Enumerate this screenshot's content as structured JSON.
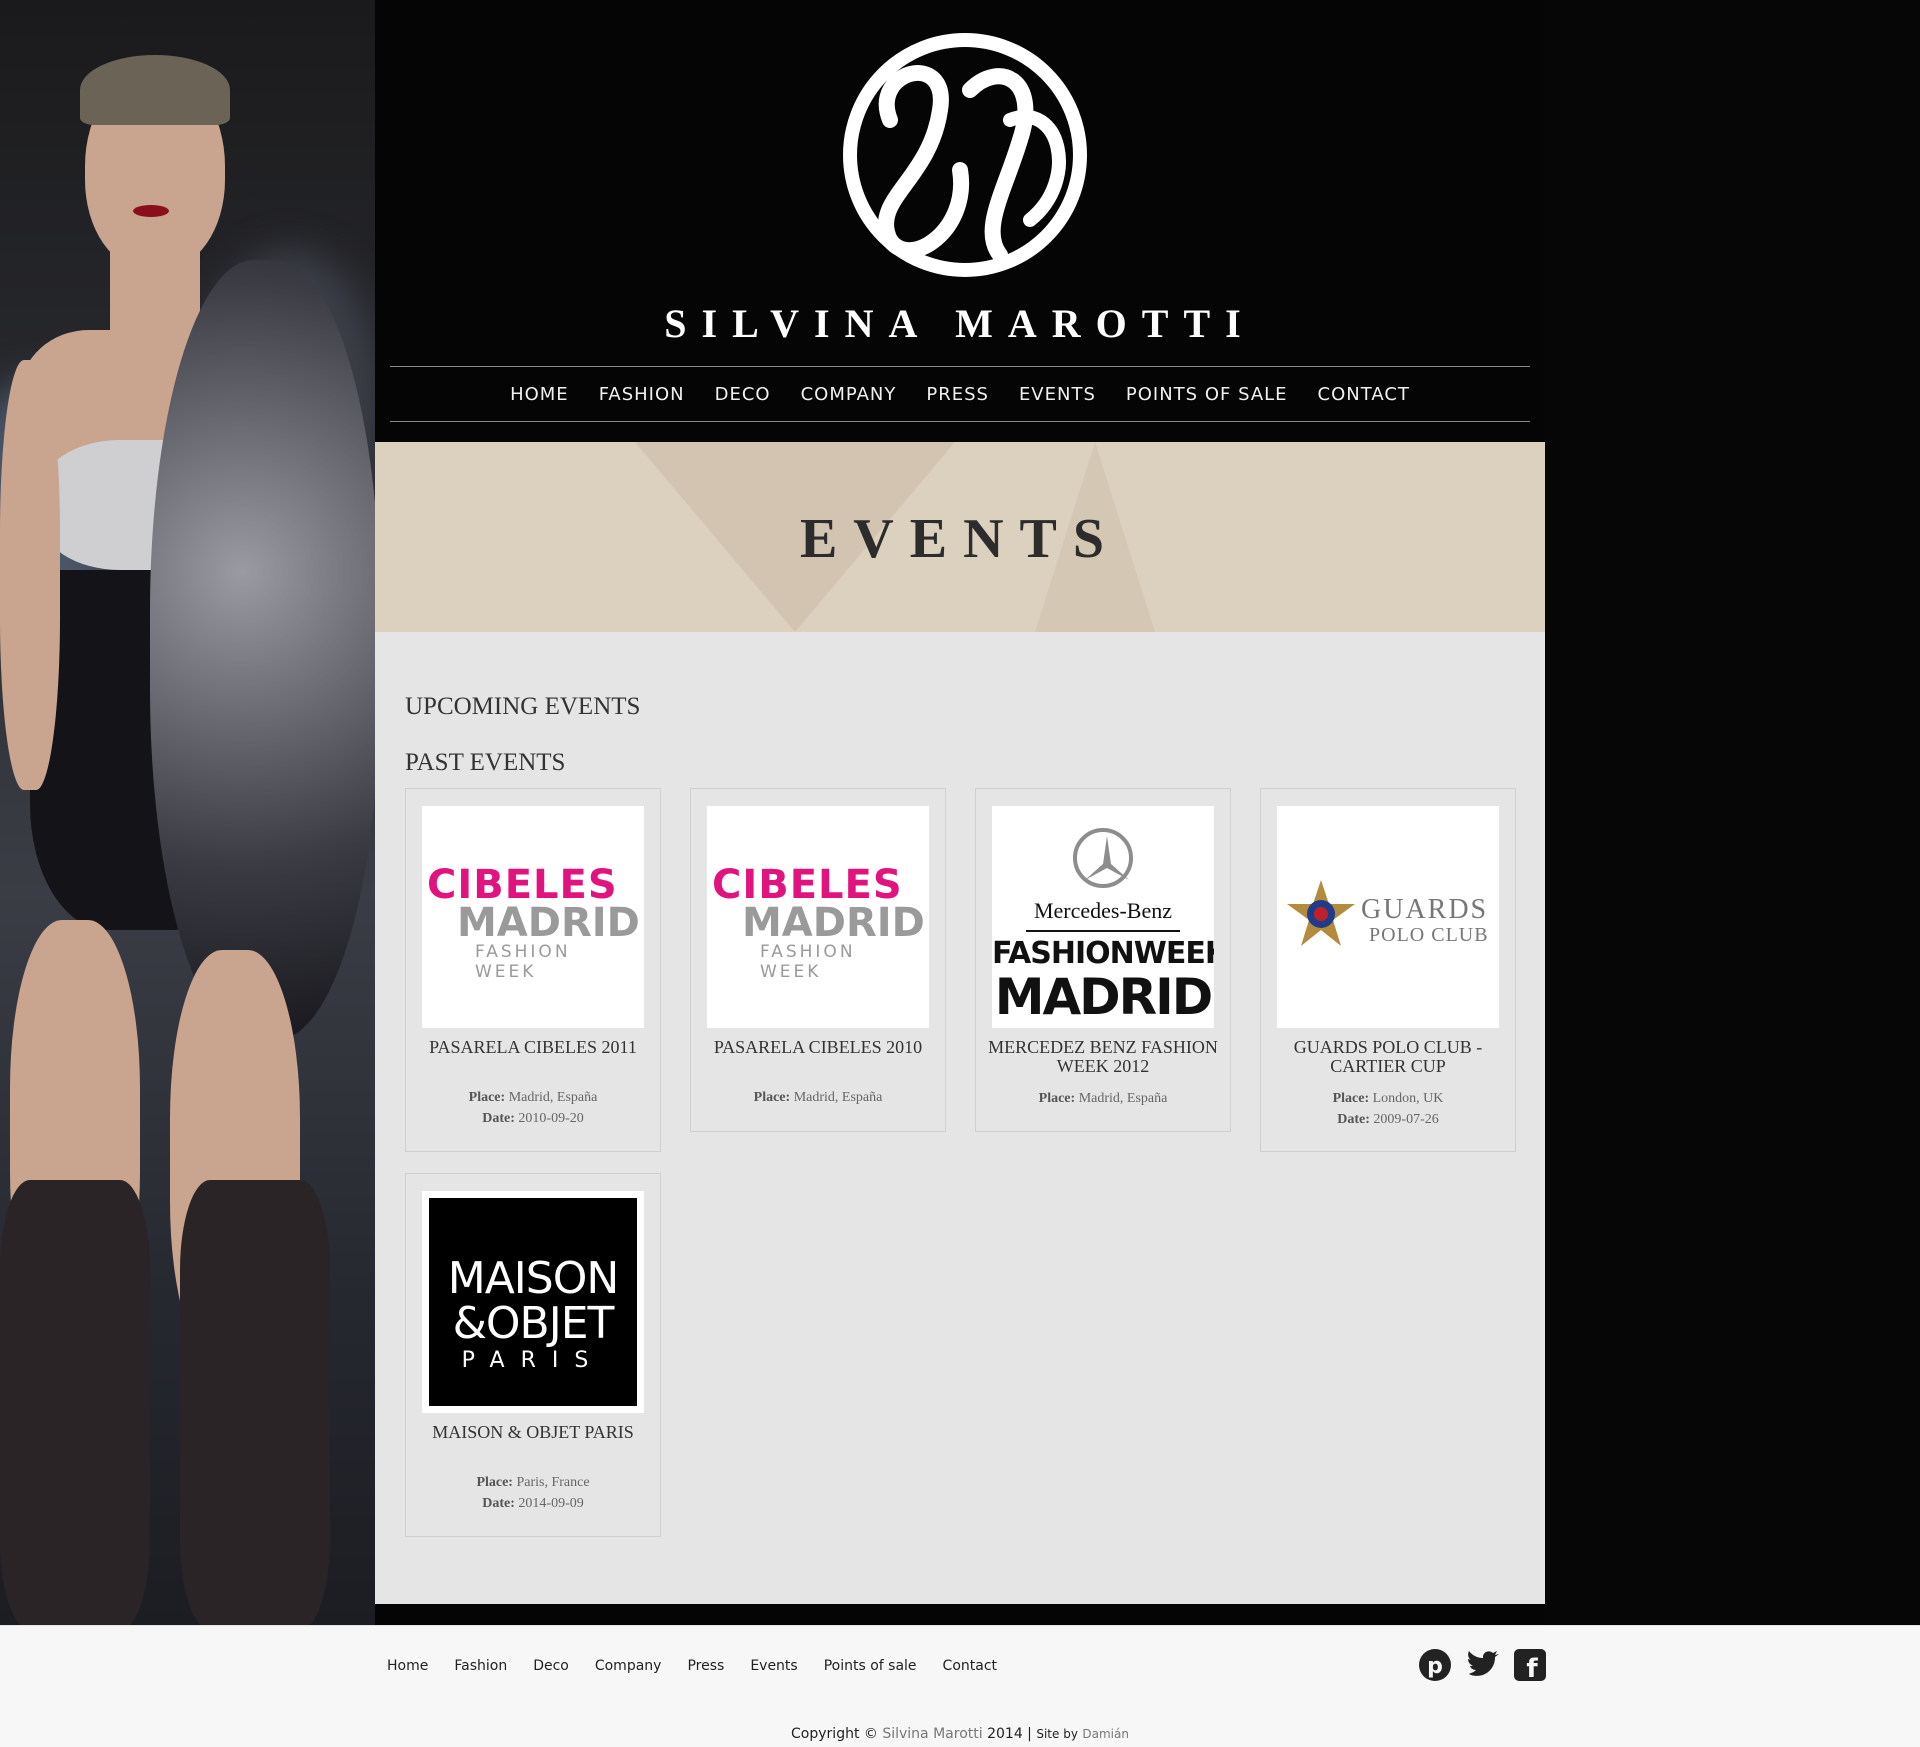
{
  "brand": {
    "name": "SILVINA MAROTTI",
    "logo_icon": "monogram-logo-icon"
  },
  "nav": {
    "items": [
      "HOME",
      "FASHION",
      "DECO",
      "COMPANY",
      "PRESS",
      "EVENTS",
      "POINTS OF SALE",
      "CONTACT"
    ]
  },
  "page": {
    "title": "EVENTS",
    "upcoming_heading": "UPCOMING EVENTS",
    "past_heading": "PAST EVENTS"
  },
  "events": [
    {
      "title": "PASAREL A CIBELES 2011",
      "place_label": "Place:",
      "place": "Madrid, España",
      "date_label": "Date:",
      "date": "2010-09-20",
      "logo": "cibeles-logo"
    },
    {
      "title": "PASARELA CIBELES 2010",
      "place_label": "Place:",
      "place": "Madrid, España",
      "logo": "cibeles-logo"
    },
    {
      "title": "MERCEDEZ BENZ FASHION WEEK 2012",
      "place_label": "Place:",
      "place": "Madrid, España",
      "logo": "mercedes-fashionweek-logo"
    },
    {
      "title": "GUARDS POLO CLUB - CARTIER CUP",
      "place_label": "Place:",
      "place": "London, UK",
      "date_label": "Date:",
      "date": "2009-07-26",
      "logo": "guards-polo-logo"
    },
    {
      "title": "MAISON & OBJET PARIS",
      "place_label": "Place:",
      "place": "Paris, France",
      "date_label": "Date:",
      "date": "2014-09-09",
      "logo": "maison-objet-logo"
    }
  ],
  "logos": {
    "cibeles": {
      "line1": "CIBELES",
      "line2": "MADRID",
      "line3": "FASHION WEEK"
    },
    "mercedes": {
      "line1": "Mercedes-Benz",
      "line2": "FASHIONWEEK",
      "line3": "MADRID"
    },
    "guards": {
      "line1": "GUARDS",
      "line2": "POLO CLUB"
    },
    "maison": {
      "line1": "MAISON",
      "line2": "&OBJET",
      "line3": "PARIS"
    }
  },
  "footer": {
    "nav": [
      "Home",
      "Fashion",
      "Deco",
      "Company",
      "Press",
      "Events",
      "Points of sale",
      "Contact"
    ],
    "social": [
      "pinterest-icon",
      "twitter-icon",
      "facebook-icon"
    ],
    "copyright_prefix": "Copyright ©",
    "copyright_name": "Silvina Marotti",
    "copyright_year": "2014 |",
    "site_by_label": "Site by",
    "site_by_name": "Damián"
  },
  "colors": {
    "background": "#050505",
    "panel": "#e5e5e5",
    "banner": "#dcd0bf",
    "cibeles_pink": "#e0137f"
  }
}
